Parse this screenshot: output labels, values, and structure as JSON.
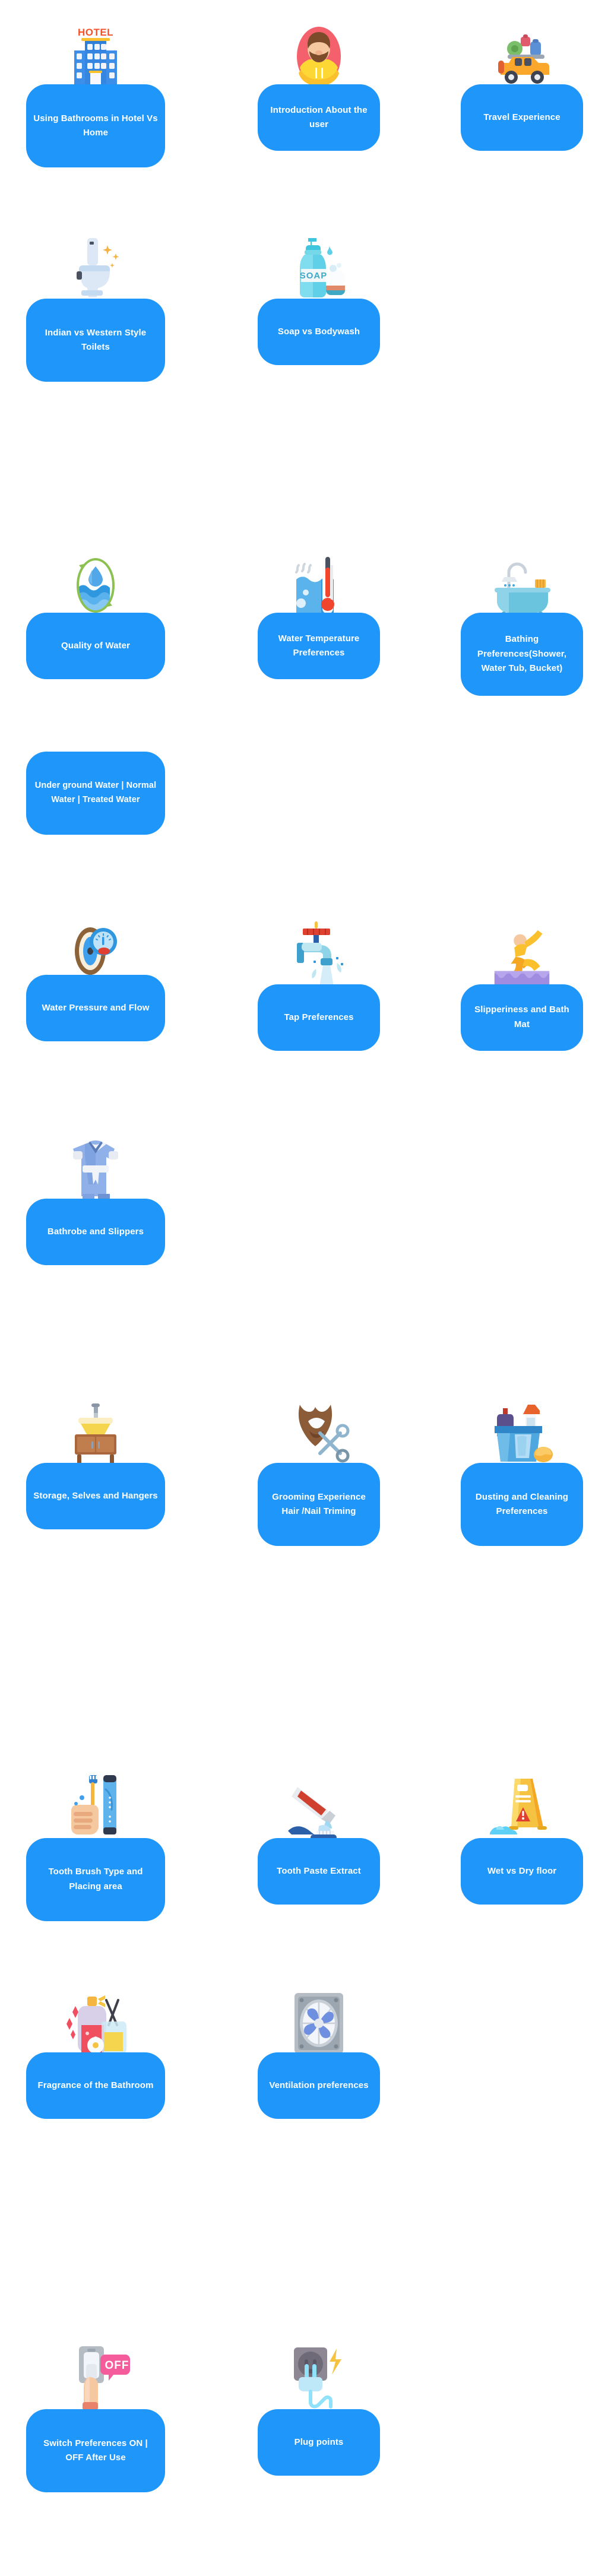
{
  "meta": {
    "accent_color": "#1E96FA",
    "background_color": "#FFFFFF",
    "label_color": "#FFFFFF"
  },
  "sections": [
    {
      "name": "introduction",
      "cards": [
        {
          "label": "Using Bathrooms in Hotel Vs Home",
          "icon": "hotel-building-icon"
        },
        {
          "label": "Introduction About the user",
          "icon": "user-avatar-icon"
        },
        {
          "label": "Travel Experience",
          "icon": "travel-car-luggage-icon"
        },
        {
          "label": "Indian vs Western Style Toilets",
          "icon": "toilet-icon"
        },
        {
          "label": "Soap vs Bodywash",
          "icon": "soap-bottle-icon"
        }
      ]
    },
    {
      "name": "water",
      "cards": [
        {
          "label": "Quality of Water",
          "icon": "water-quality-drop-icon"
        },
        {
          "label": "Water Temperature Preferences",
          "icon": "water-thermometer-icon"
        },
        {
          "label": "Bathing Preferences(Shower, Water Tub, Bucket)",
          "icon": "bathtub-shower-icon"
        },
        {
          "label": "Under ground Water | Normal Water | Treated Water",
          "icon": "none"
        },
        {
          "label": "Water Pressure and Flow",
          "icon": "pressure-gauge-icon"
        },
        {
          "label": "Tap Preferences",
          "icon": "tap-faucet-icon"
        },
        {
          "label": "Slipperiness and Bath Mat",
          "icon": "slipping-person-mat-icon"
        },
        {
          "label": "Bathrobe and Slippers",
          "icon": "bathrobe-icon"
        }
      ]
    },
    {
      "name": "grooming-cleaning",
      "cards": [
        {
          "label": "Storage, Selves and Hangers",
          "icon": "sink-cabinet-icon"
        },
        {
          "label": "Grooming Experience Hair /Nail Triming",
          "icon": "beard-scissors-icon"
        },
        {
          "label": "Dusting and Cleaning Preferences",
          "icon": "cleaning-bucket-icon"
        }
      ]
    },
    {
      "name": "hygiene",
      "cards": [
        {
          "label": "Tooth Brush Type and Placing area",
          "icon": "toothbrush-hand-icon"
        },
        {
          "label": "Tooth Paste Extract",
          "icon": "toothpaste-tube-icon"
        },
        {
          "label": "Wet vs Dry floor",
          "icon": "wet-floor-sign-icon"
        },
        {
          "label": "Fragrance of the Bathroom",
          "icon": "fragrance-diffuser-icon"
        },
        {
          "label": "Ventilation preferences",
          "icon": "exhaust-fan-icon"
        }
      ]
    },
    {
      "name": "electrical",
      "cards": [
        {
          "label": "Switch Preferences ON | OFF After Use",
          "icon": "light-switch-off-icon"
        },
        {
          "label": "Plug points",
          "icon": "plug-socket-icon"
        }
      ]
    }
  ],
  "cards": [
    {
      "id": "c1",
      "label": "Using Bathrooms in Hotel Vs Home",
      "icon": "hotel-building-icon"
    },
    {
      "id": "c2",
      "label": "Introduction About the user",
      "icon": "user-avatar-icon"
    },
    {
      "id": "c3",
      "label": "Travel Experience",
      "icon": "travel-car-luggage-icon"
    },
    {
      "id": "c4",
      "label": "Indian vs Western Style Toilets",
      "icon": "toilet-icon"
    },
    {
      "id": "c5",
      "label": "Soap vs Bodywash",
      "icon": "soap-bottle-icon"
    },
    {
      "id": "c6",
      "label": "Quality of Water",
      "icon": "water-quality-drop-icon"
    },
    {
      "id": "c7",
      "label": "Water Temperature Preferences",
      "icon": "water-thermometer-icon"
    },
    {
      "id": "c8",
      "label": "Bathing Preferences(Shower, Water Tub, Bucket)",
      "icon": "bathtub-shower-icon"
    },
    {
      "id": "c9",
      "label": "Under ground Water | Normal Water | Treated Water",
      "icon": "none"
    },
    {
      "id": "c10",
      "label": "Water Pressure and Flow",
      "icon": "pressure-gauge-icon"
    },
    {
      "id": "c11",
      "label": "Tap Preferences",
      "icon": "tap-faucet-icon"
    },
    {
      "id": "c12",
      "label": "Slipperiness and Bath Mat",
      "icon": "slipping-person-mat-icon"
    },
    {
      "id": "c13",
      "label": "Bathrobe and Slippers",
      "icon": "bathrobe-icon"
    },
    {
      "id": "c14",
      "label": "Storage, Selves and Hangers",
      "icon": "sink-cabinet-icon"
    },
    {
      "id": "c15",
      "label": "Grooming Experience Hair /Nail Triming",
      "icon": "beard-scissors-icon"
    },
    {
      "id": "c16",
      "label": "Dusting and Cleaning Preferences",
      "icon": "cleaning-bucket-icon"
    },
    {
      "id": "c17",
      "label": "Tooth Brush Type and Placing area",
      "icon": "toothbrush-hand-icon"
    },
    {
      "id": "c18",
      "label": "Tooth Paste Extract",
      "icon": "toothpaste-tube-icon"
    },
    {
      "id": "c19",
      "label": "Wet vs Dry floor",
      "icon": "wet-floor-sign-icon"
    },
    {
      "id": "c20",
      "label": "Fragrance of the Bathroom",
      "icon": "fragrance-diffuser-icon"
    },
    {
      "id": "c21",
      "label": "Ventilation preferences",
      "icon": "exhaust-fan-icon"
    },
    {
      "id": "c22",
      "label": "Switch Preferences ON | OFF After Use",
      "icon": "light-switch-off-icon"
    },
    {
      "id": "c23",
      "label": "Plug points",
      "icon": "plug-socket-icon"
    }
  ],
  "icon_text": {
    "hotel_sign": "HOTEL",
    "soap_label": "SOAP",
    "switch_off_bubble": "OFF"
  }
}
